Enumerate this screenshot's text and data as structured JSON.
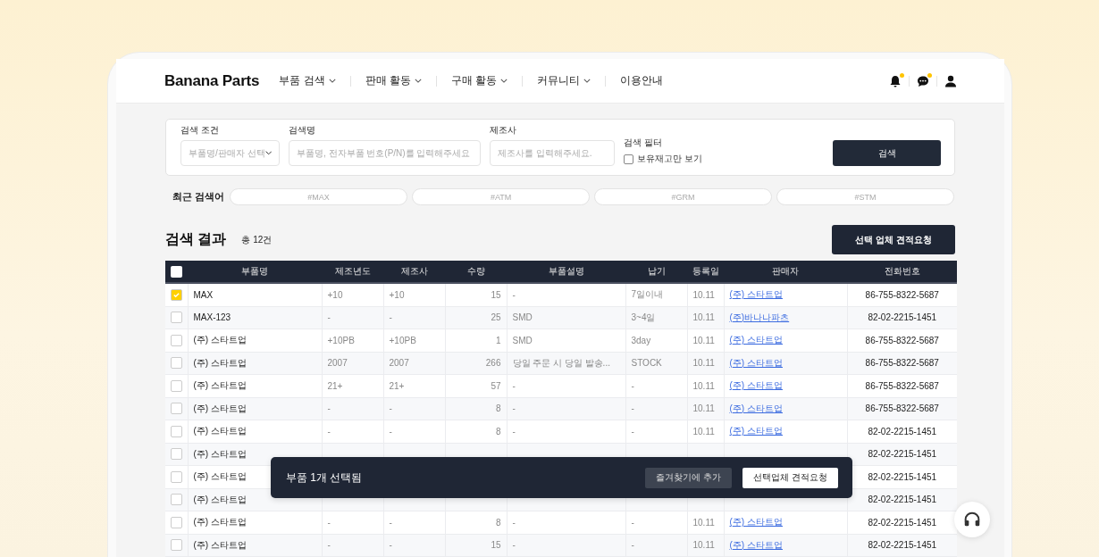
{
  "brand": {
    "logo": "Banana Parts"
  },
  "nav": [
    {
      "label": "부품 검색",
      "dropdown": true
    },
    {
      "label": "판매 활동",
      "dropdown": true
    },
    {
      "label": "구매 활동",
      "dropdown": true
    },
    {
      "label": "커뮤니티",
      "dropdown": true
    },
    {
      "label": "이용안내",
      "dropdown": false
    }
  ],
  "header_icons": [
    {
      "kind": "bell",
      "badge": true
    },
    {
      "kind": "chat",
      "badge": true
    },
    {
      "kind": "user",
      "badge": false
    }
  ],
  "search": {
    "condition": {
      "label": "검색 조건",
      "placeholder": "부품명/판매자 선택"
    },
    "name": {
      "label": "검색명",
      "placeholder": "부품명, 전자부품 번호(P/N)를 입력해주세요"
    },
    "maker": {
      "label": "제조사",
      "placeholder": "제조사를 입력해주세요."
    },
    "filter": {
      "label": "검색 필터",
      "option": "보유재고만 보기",
      "checked": false
    },
    "button": "검색"
  },
  "recent": {
    "label": "최근 검색어",
    "tags": [
      "#MAX",
      "#ATM",
      "#GRM",
      "#STM"
    ]
  },
  "results": {
    "title": "검색 결과",
    "count": "총 12건",
    "quote_button": "선택 업체 견적요청"
  },
  "table": {
    "all_checked": false,
    "columns": [
      {
        "label": "부품명",
        "kind": "name"
      },
      {
        "label": "제조년도",
        "kind": "text"
      },
      {
        "label": "제조사",
        "kind": "text"
      },
      {
        "label": "수량",
        "kind": "number"
      },
      {
        "label": "부품설명",
        "kind": "text"
      },
      {
        "label": "납기",
        "kind": "text"
      },
      {
        "label": "등록일",
        "kind": "text"
      },
      {
        "label": "판매자",
        "kind": "link"
      },
      {
        "label": "전화번호",
        "kind": "phone"
      }
    ],
    "rows": [
      {
        "checked": true,
        "cells": [
          "MAX",
          "+10",
          "+10",
          "15",
          "-",
          "7일이내",
          "10.11",
          "(주) 스타트업",
          "86-755-8322-5687"
        ]
      },
      {
        "checked": false,
        "cells": [
          "MAX-123",
          "-",
          "-",
          "25",
          "SMD",
          "3~4일",
          "10.11",
          "(주)바나나파츠",
          "82-02-2215-1451"
        ]
      },
      {
        "checked": false,
        "cells": [
          "(주) 스타트업",
          "+10PB",
          "+10PB",
          "1",
          "SMD",
          "3day",
          "10.11",
          "(주) 스타트업",
          "86-755-8322-5687"
        ]
      },
      {
        "checked": false,
        "cells": [
          "(주) 스타트업",
          "2007",
          "2007",
          "266",
          "당일 주문 시 당일 발송...",
          "STOCK",
          "10.11",
          "(주) 스타트업",
          "86-755-8322-5687"
        ]
      },
      {
        "checked": false,
        "cells": [
          "(주) 스타트업",
          "21+",
          "21+",
          "57",
          "-",
          "-",
          "10.11",
          "(주) 스타트업",
          "86-755-8322-5687"
        ]
      },
      {
        "checked": false,
        "cells": [
          "(주) 스타트업",
          "-",
          "-",
          "8",
          "-",
          "-",
          "10.11",
          "(주) 스타트업",
          "86-755-8322-5687"
        ]
      },
      {
        "checked": false,
        "cells": [
          "(주) 스타트업",
          "-",
          "-",
          "8",
          "-",
          "-",
          "10.11",
          "(주) 스타트업",
          "82-02-2215-1451"
        ]
      },
      {
        "checked": false,
        "cells": [
          "(주) 스타트업",
          null,
          null,
          null,
          null,
          null,
          null,
          null,
          "82-02-2215-1451"
        ]
      },
      {
        "checked": false,
        "cells": [
          "(주) 스타트업",
          null,
          null,
          null,
          null,
          null,
          null,
          null,
          "82-02-2215-1451"
        ]
      },
      {
        "checked": false,
        "cells": [
          "(주) 스타트업",
          null,
          null,
          null,
          null,
          null,
          null,
          null,
          "82-02-2215-1451"
        ]
      },
      {
        "checked": false,
        "cells": [
          "(주) 스타트업",
          "-",
          "-",
          "8",
          "-",
          "-",
          "10.11",
          "(주) 스타트업",
          "82-02-2215-1451"
        ]
      },
      {
        "checked": false,
        "cells": [
          "(주) 스타트업",
          "-",
          "-",
          "15",
          "-",
          "-",
          "10.11",
          "(주) 스타트업",
          "82-02-2215-1451"
        ]
      }
    ]
  },
  "selection_bar": {
    "message": "부품 1개 선택됨",
    "buttons": [
      {
        "label": "즐겨찾기에 추가",
        "kind": "secondary"
      },
      {
        "label": "선택업체 견적요청",
        "kind": "primary"
      }
    ]
  }
}
